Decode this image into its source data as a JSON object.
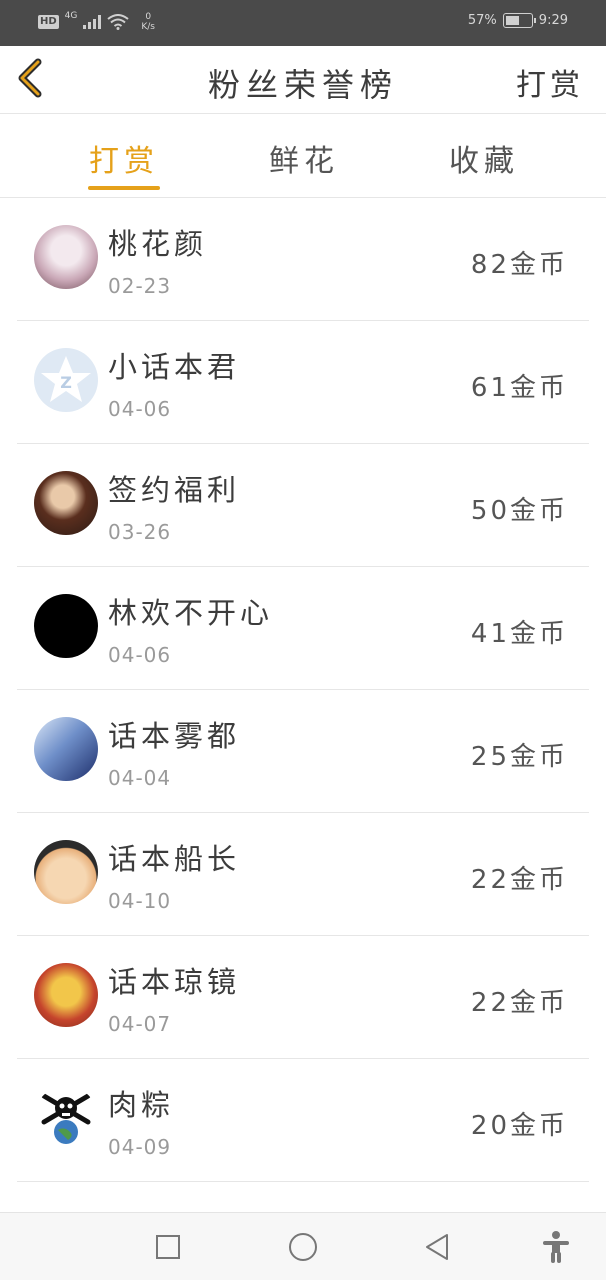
{
  "status_bar": {
    "hd": "HD",
    "network": "4G",
    "speed_value": "0",
    "speed_unit": "K/s",
    "battery": "57%",
    "battery_level": 0.57,
    "time": "9:29"
  },
  "header": {
    "back_icon": "chevron-left-icon",
    "title": "粉丝荣誉榜",
    "action": "打赏"
  },
  "tabs": [
    {
      "label": "打赏",
      "active": true
    },
    {
      "label": "鲜花",
      "active": false
    },
    {
      "label": "收藏",
      "active": false
    }
  ],
  "accent_color": "#e5a11a",
  "list": [
    {
      "name": "桃花颜",
      "date": "02-23",
      "amount": "82金币"
    },
    {
      "name": "小话本君",
      "date": "04-06",
      "amount": "61金币"
    },
    {
      "name": "签约福利",
      "date": "03-26",
      "amount": "50金币"
    },
    {
      "name": "林欢不开心",
      "date": "04-06",
      "amount": "41金币"
    },
    {
      "name": "话本雾都",
      "date": "04-04",
      "amount": "25金币"
    },
    {
      "name": "话本船长",
      "date": "04-10",
      "amount": "22金币"
    },
    {
      "name": "话本琼镜",
      "date": "04-07",
      "amount": "22金币"
    },
    {
      "name": "肉粽",
      "date": "04-09",
      "amount": "20金币"
    }
  ],
  "bottom_nav": {
    "recents": "square-icon",
    "home": "circle-icon",
    "back": "triangle-back-icon",
    "accessibility": "accessibility-icon"
  }
}
